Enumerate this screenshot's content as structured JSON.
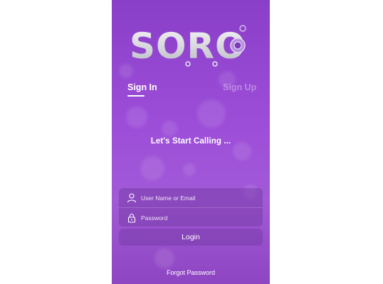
{
  "app": {
    "logo_text": "SORO"
  },
  "tabs": [
    {
      "label": "Sign In",
      "active": true
    },
    {
      "label": "Sign Up",
      "active": false
    }
  ],
  "headline": "Let's Start Calling ...",
  "form": {
    "username_placeholder": "User Name or Email",
    "password_placeholder": "Password",
    "login_label": "Login",
    "forgot_label": "Forgot Password"
  },
  "colors": {
    "background_top": "#8a3fc8",
    "background_mid": "#9d4ed9",
    "text": "#ffffff"
  },
  "icons": {
    "user_field": "person-icon",
    "password_field": "lock-icon"
  }
}
